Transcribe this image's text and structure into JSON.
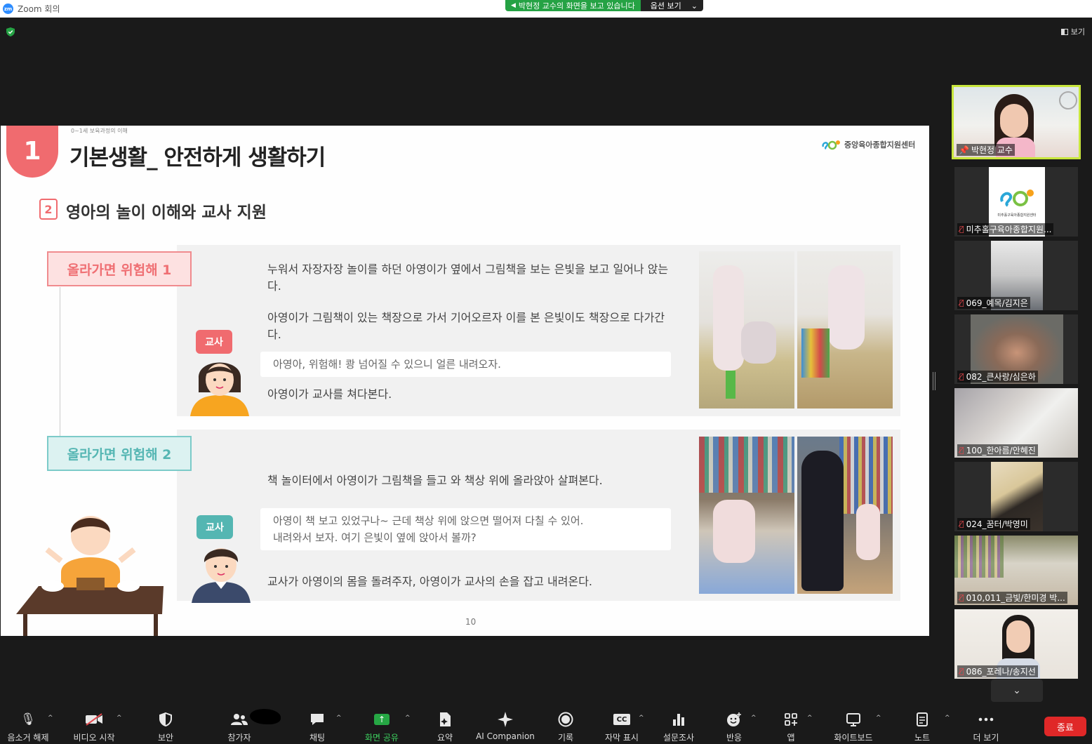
{
  "window": {
    "title": "Zoom 회의"
  },
  "share_banner": {
    "message": "박현정 교수의 화면을 보고 있습니다",
    "options_label": "옵션 보기",
    "caret": "⌄"
  },
  "view_button": {
    "label": "보기"
  },
  "slide": {
    "number": "1",
    "breadcrumb": "0~1세 보육과정의 이해",
    "title": "기본생활_ 안전하게 생활하기",
    "org_logo_text": "중앙육아종합지원센터",
    "sub_number": "2",
    "sub_title": "영아의 놀이 이해와 교사 지원",
    "scenarios": [
      {
        "tag": "올라가면 위험해 1",
        "teacher_badge": "교사",
        "line1": "누워서 자장자장 놀이를 하던 아영이가 옆에서 그림책을 보는 은빛을 보고 일어나 앉는다.",
        "line2": "아영이가 그림책이 있는 책장으로 가서 기어오르자 이를 본 은빛이도 책장으로 다가간다.",
        "quote": "아영아, 위험해! 쾅 넘어질 수 있으니 얼른 내려오자.",
        "line3": "아영이가 교사를 쳐다본다."
      },
      {
        "tag": "올라가면 위험해 2",
        "teacher_badge": "교사",
        "line1": "책 놀이터에서 아영이가 그림책을 들고 와 책상 위에 올라앉아 살펴본다.",
        "quote_line1": "아영이 책 보고 있었구나~ 근데 책상 위에 앉으면 떨어져 다칠 수 있어.",
        "quote_line2": "내려와서 보자. 여기 은빛이 옆에 앉아서 볼까?",
        "line3": "교사가 아영이의 몸을 돌려주자, 아영이가 교사의 손을 잡고 내려온다."
      }
    ],
    "page_number": "10"
  },
  "participants": [
    {
      "name": "박현정 교수",
      "active": true,
      "muted": false
    },
    {
      "name": "미추홀구육아종합지원...",
      "muted": true,
      "logo_caption": "미추홀구육아종합지원센터"
    },
    {
      "name": "069_예목/김지은",
      "muted": true
    },
    {
      "name": "082_큰사랑/심은하",
      "muted": true
    },
    {
      "name": "100_한아름/안혜진",
      "muted": true
    },
    {
      "name": "024_꿈터/박영미",
      "muted": true
    },
    {
      "name": "010,011_금빛/한미경 박...",
      "muted": true
    },
    {
      "name": "086_포레나/송지선",
      "muted": true
    }
  ],
  "toolbar": {
    "items": [
      {
        "label": "음소거 해제",
        "icon": "mic-off-icon"
      },
      {
        "label": "비디오 시작",
        "icon": "video-off-icon"
      },
      {
        "label": "보안",
        "icon": "shield-icon"
      },
      {
        "label": "참가자",
        "icon": "participants-icon"
      },
      {
        "label": "채팅",
        "icon": "chat-icon"
      },
      {
        "label": "화면 공유",
        "icon": "share-screen-icon"
      },
      {
        "label": "요약",
        "icon": "summary-icon"
      },
      {
        "label": "AI Companion",
        "icon": "ai-companion-icon"
      },
      {
        "label": "기록",
        "icon": "record-icon"
      },
      {
        "label": "자막 표시",
        "icon": "captions-icon"
      },
      {
        "label": "설문조사",
        "icon": "poll-icon"
      },
      {
        "label": "반응",
        "icon": "reaction-icon"
      },
      {
        "label": "앱",
        "icon": "apps-icon"
      },
      {
        "label": "화이트보드",
        "icon": "whiteboard-icon"
      },
      {
        "label": "노트",
        "icon": "notes-icon"
      },
      {
        "label": "더 보기",
        "icon": "more-icon"
      }
    ],
    "captions_glyph": "CC",
    "end_label": "종료",
    "caret": "^",
    "more_glyph": "⌄"
  },
  "colors": {
    "accent_green": "#25a244",
    "end_red": "#e02828",
    "slide_pink": "#f06b6f",
    "slide_teal": "#54b6b2",
    "active_speaker": "#c8e63c"
  }
}
